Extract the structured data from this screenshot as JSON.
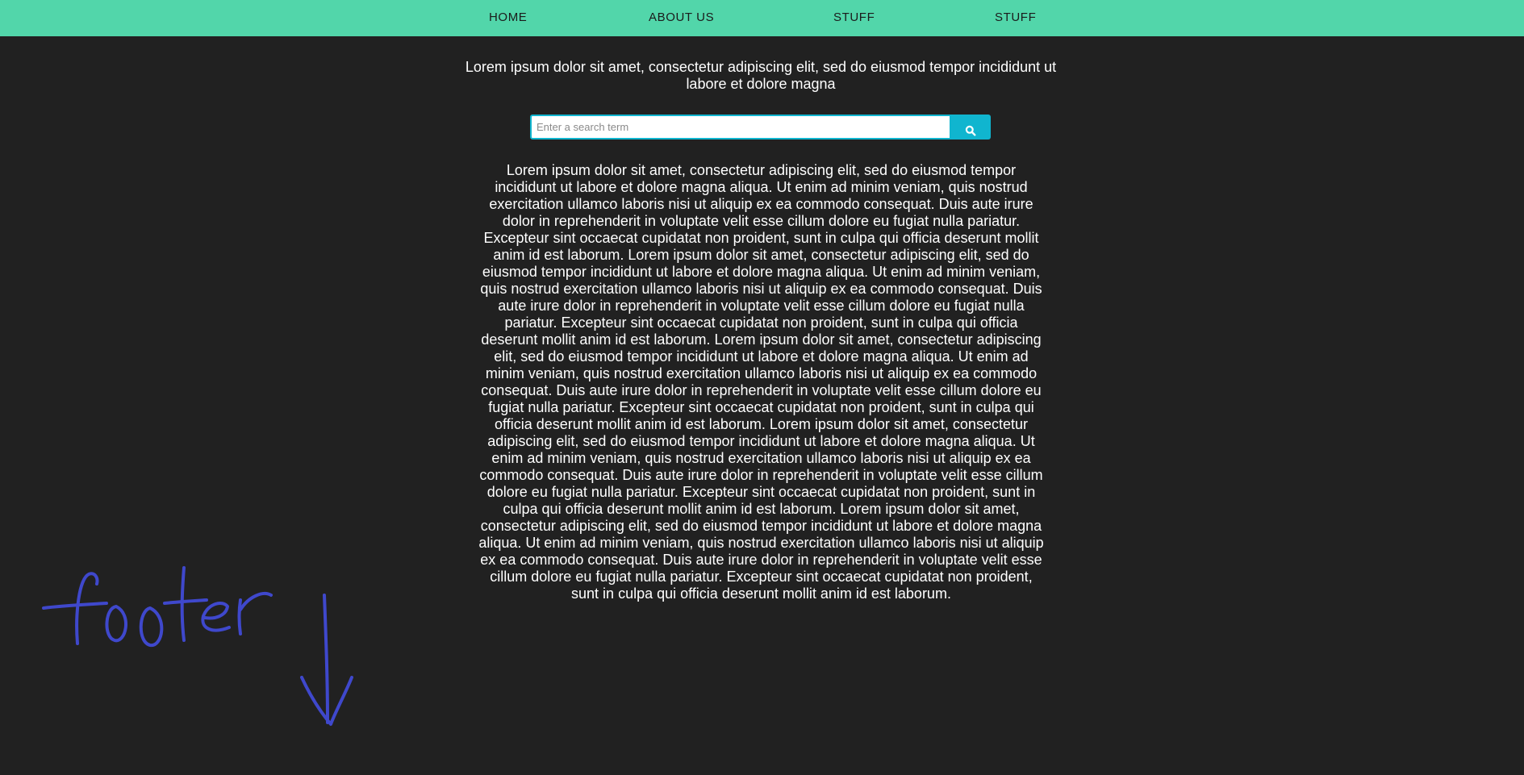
{
  "nav": {
    "items": [
      {
        "label": "HOME"
      },
      {
        "label": "ABOUT US"
      },
      {
        "label": "STUFF"
      },
      {
        "label": "STUFF"
      }
    ],
    "background": "#52d6aa"
  },
  "intro": {
    "text": "Lorem ipsum dolor sit amet, consectetur adipiscing elit, sed do eiusmod tempor incididunt ut labore et dolore magna"
  },
  "search": {
    "placeholder": "Enter a search term",
    "value": "",
    "button_icon": "search-icon",
    "accent": "#10b5cf"
  },
  "content": {
    "text": "Lorem ipsum dolor sit amet, consectetur adipiscing elit, sed do eiusmod tempor incididunt ut labore et dolore magna aliqua. Ut enim ad minim veniam, quis nostrud exercitation ullamco laboris nisi ut aliquip ex ea commodo consequat. Duis aute irure dolor in reprehenderit in voluptate velit esse cillum dolore eu fugiat nulla pariatur. Excepteur sint occaecat cupidatat non proident, sunt in culpa qui officia deserunt mollit anim id est laborum. Lorem ipsum dolor sit amet, consectetur adipiscing elit, sed do eiusmod tempor incididunt ut labore et dolore magna aliqua. Ut enim ad minim veniam, quis nostrud exercitation ullamco laboris nisi ut aliquip ex ea commodo consequat. Duis aute irure dolor in reprehenderit in voluptate velit esse cillum dolore eu fugiat nulla pariatur. Excepteur sint occaecat cupidatat non proident, sunt in culpa qui officia deserunt mollit anim id est laborum. Lorem ipsum dolor sit amet, consectetur adipiscing elit, sed do eiusmod tempor incididunt ut labore et dolore magna aliqua. Ut enim ad minim veniam, quis nostrud exercitation ullamco laboris nisi ut aliquip ex ea commodo consequat. Duis aute irure dolor in reprehenderit in voluptate velit esse cillum dolore eu fugiat nulla pariatur. Excepteur sint occaecat cupidatat non proident, sunt in culpa qui officia deserunt mollit anim id est laborum. Lorem ipsum dolor sit amet, consectetur adipiscing elit, sed do eiusmod tempor incididunt ut labore et dolore magna aliqua. Ut enim ad minim veniam, quis nostrud exercitation ullamco laboris nisi ut aliquip ex ea commodo consequat. Duis aute irure dolor in reprehenderit in voluptate velit esse cillum dolore eu fugiat nulla pariatur. Excepteur sint occaecat cupidatat non proident, sunt in culpa qui officia deserunt mollit anim id est laborum. Lorem ipsum dolor sit amet, consectetur adipiscing elit, sed do eiusmod tempor incididunt ut labore et dolore magna aliqua. Ut enim ad minim veniam, quis nostrud exercitation ullamco laboris nisi ut aliquip ex ea commodo consequat. Duis aute irure dolor in reprehenderit in voluptate velit esse cillum dolore eu fugiat nulla pariatur. Excepteur sint occaecat cupidatat non proident, sunt in culpa qui officia deserunt mollit anim id est laborum."
  },
  "annotation": {
    "text": "footer",
    "color": "#3f48cc",
    "icon": "arrow-down-icon"
  }
}
